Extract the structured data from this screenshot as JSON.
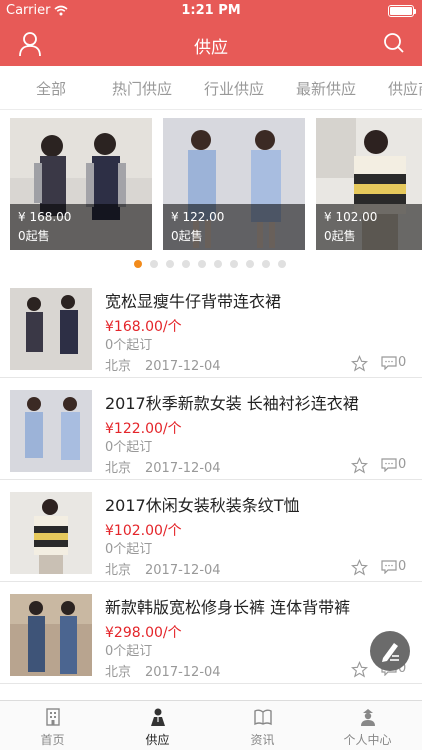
{
  "status_bar": {
    "carrier": "Carrier",
    "time": "1:21 PM"
  },
  "nav": {
    "title": "供应",
    "user_icon": "user-icon",
    "search_icon": "search-icon"
  },
  "tabs": [
    {
      "label": "全部"
    },
    {
      "label": "热门供应"
    },
    {
      "label": "行业供应"
    },
    {
      "label": "最新供应"
    },
    {
      "label": "供应商"
    }
  ],
  "carousel": {
    "slides": [
      {
        "price": "¥ 168.00",
        "moq": "0起售"
      },
      {
        "price": "¥ 122.00",
        "moq": "0起售"
      },
      {
        "price": "¥ 102.00",
        "moq": "0起售"
      }
    ],
    "page_count": 10,
    "current_page": 1
  },
  "items": [
    {
      "name": "宽松显瘦牛仔背带连衣裙",
      "price": "¥168.00/个",
      "moq": "0个起订",
      "city": "北京",
      "date": "2017-12-04",
      "comments": "0"
    },
    {
      "name": "2017秋季新款女装 长袖衬衫连衣裙",
      "price": "¥122.00/个",
      "moq": "0个起订",
      "city": "北京",
      "date": "2017-12-04",
      "comments": "0"
    },
    {
      "name": "2017休闲女装秋装条纹T恤",
      "price": "¥102.00/个",
      "moq": "0个起订",
      "city": "北京",
      "date": "2017-12-04",
      "comments": "0"
    },
    {
      "name": "新款韩版宽松修身长裤 连体背带裤",
      "price": "¥298.00/个",
      "moq": "0个起订",
      "city": "北京",
      "date": "2017-12-04",
      "comments": "0"
    }
  ],
  "fab": {
    "icon": "edit-icon"
  },
  "tabbar": [
    {
      "label": "首页",
      "icon": "building-icon",
      "active": false
    },
    {
      "label": "供应",
      "icon": "supply-icon",
      "active": true
    },
    {
      "label": "资讯",
      "icon": "book-icon",
      "active": false
    },
    {
      "label": "个人中心",
      "icon": "person-icon",
      "active": false
    }
  ],
  "colors": {
    "brand": "#e75a57",
    "price": "#e4252a",
    "dot_active": "#f28b1b"
  }
}
